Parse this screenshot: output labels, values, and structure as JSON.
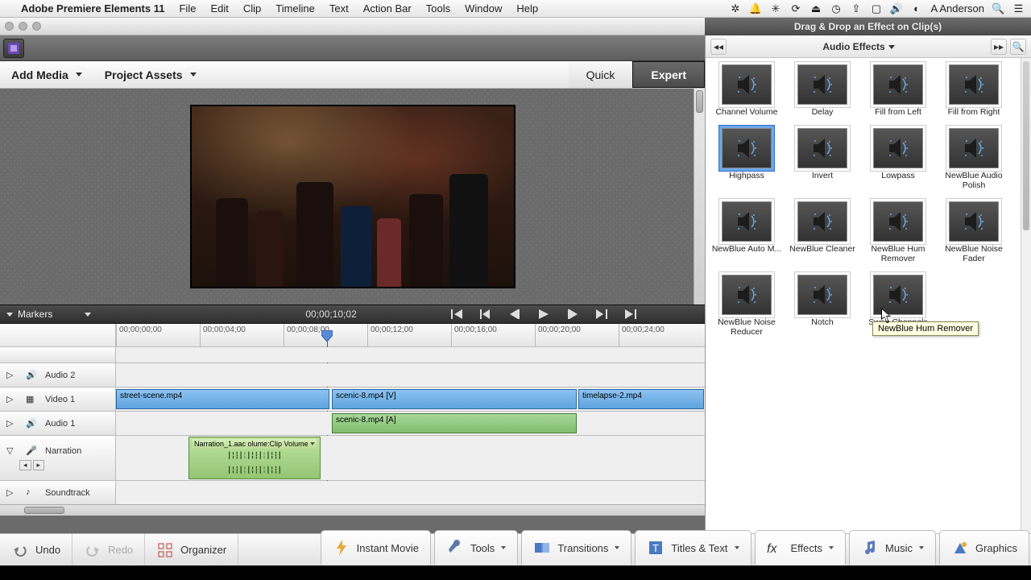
{
  "menubar": {
    "apple": "",
    "app": "Adobe Premiere Elements 11",
    "items": [
      "File",
      "Edit",
      "Clip",
      "Timeline",
      "Text",
      "Action Bar",
      "Tools",
      "Window",
      "Help"
    ],
    "user": "A Anderson"
  },
  "effects_panel": {
    "title": "Drag & Drop an Effect on Clip(s)",
    "category": "Audio Effects",
    "items": [
      {
        "label": "Channel Volume"
      },
      {
        "label": "Delay"
      },
      {
        "label": "Fill from Left"
      },
      {
        "label": "Fill from Right"
      },
      {
        "label": "Highpass",
        "selected": true
      },
      {
        "label": "Invert"
      },
      {
        "label": "Lowpass"
      },
      {
        "label": "NewBlue Audio Polish"
      },
      {
        "label": "NewBlue Auto M..."
      },
      {
        "label": "NewBlue Cleaner"
      },
      {
        "label": "NewBlue Hum Remover"
      },
      {
        "label": "NewBlue Noise Fader"
      },
      {
        "label": "NewBlue Noise Reducer"
      },
      {
        "label": "Notch"
      },
      {
        "label": "Swap Channels"
      }
    ],
    "tooltip": "NewBlue Hum Remover"
  },
  "assets_bar": {
    "add_media": "Add Media",
    "project_assets": "Project Assets",
    "quick": "Quick",
    "expert": "Expert"
  },
  "transport": {
    "markers_label": "Markers",
    "timecode": "00;00;10;02"
  },
  "ruler": {
    "ticks": [
      "00;00;00;00",
      "00;00;04;00",
      "00;00;08;00",
      "00;00;12;00",
      "00;00;16;00",
      "00;00;20;00",
      "00;00;24;00"
    ]
  },
  "tracks": {
    "audio2": "Audio 2",
    "video1": "Video 1",
    "audio1": "Audio 1",
    "narration": "Narration",
    "soundtrack": "Soundtrack",
    "clips": {
      "v1a": "street-scene.mp4",
      "v1b": "scenic-8.mp4 [V]",
      "v1c": "timelapse-2.mp4",
      "a1a": "scenic-8.mp4 [A]",
      "narr": "Narration_1.aac olume:Clip Volume"
    }
  },
  "bottom": {
    "undo": "Undo",
    "redo": "Redo",
    "organizer": "Organizer",
    "instant": "Instant Movie",
    "tools": "Tools",
    "transitions": "Transitions",
    "titles": "Titles & Text",
    "effects": "Effects",
    "music": "Music",
    "graphics": "Graphics"
  }
}
